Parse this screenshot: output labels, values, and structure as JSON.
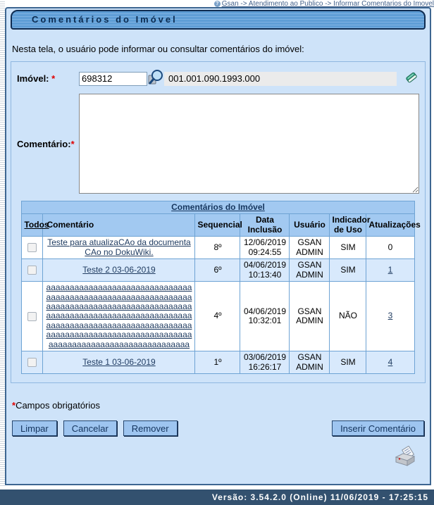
{
  "breadcrumb": {
    "text": "Gsan -> Atendimento ao Publico -> Informar Comentarios do Imovel",
    "help_icon": "question-mark-circle-icon"
  },
  "page": {
    "title": "Comentários do Imóvel",
    "description": "Nesta tela, o usuário pode informar ou consultar comentários do imóvel:"
  },
  "form": {
    "imovel": {
      "label": "Imóvel:",
      "required_marker": "*",
      "value": "698312",
      "inscricao": "001.001.090.1993.000",
      "search_icon": "magnifier",
      "clear_icon": "eraser"
    },
    "comentario": {
      "label": "Comentário:",
      "required_marker": "*",
      "value": ""
    }
  },
  "table": {
    "caption": "Comentários do Imóvel",
    "columns": [
      "Todos",
      "Comentário",
      "Sequencial",
      "Data Inclusão",
      "Usuário",
      "Indicador de Uso",
      "Atualizações"
    ],
    "rows": [
      {
        "checked": false,
        "comentario": "Teste para atualizaCAo da documentaCAo no DokuWiki.",
        "sequencial": "8º",
        "data_inclusao": "12/06/2019 09:24:55",
        "usuario": "GSAN ADMIN",
        "indicador_de_uso": "SIM",
        "atualizacoes": "0",
        "atualizacoes_is_link": false
      },
      {
        "checked": false,
        "comentario": "Teste 2 03-06-2019",
        "sequencial": "6º",
        "data_inclusao": "04/06/2019 10:13:40",
        "usuario": "GSAN ADMIN",
        "indicador_de_uso": "SIM",
        "atualizacoes": "1",
        "atualizacoes_is_link": true
      },
      {
        "checked": false,
        "comentario": "aaaaaaaaaaaaaaaaaaaaaaaaaaaaaaaaaaaaaaaaaaaaaaaaaaaaaaaaaaaaaaaaaaaaaaaaaaaaaaaaaaaaaaaaaaaaaaaaaaaaaaaaaaaaaaaaaaaaaaaaaaaaaaaaaaaaaaaaaaaaaaaaaaaaaaaaaaaaaaaaaaaaaaaaaaaaaaaaaaaaaaaaaaaaaaaaaaaaaaaaaaaaaaaaaaaaaaaa",
        "sequencial": "4º",
        "data_inclusao": "04/06/2019 10:32:01",
        "usuario": "GSAN ADMIN",
        "indicador_de_uso": "NÃO",
        "atualizacoes": "3",
        "atualizacoes_is_link": true
      },
      {
        "checked": false,
        "comentario": "Teste 1 03-06-2019",
        "sequencial": "1º",
        "data_inclusao": "03/06/2019 16:26:17",
        "usuario": "GSAN ADMIN",
        "indicador_de_uso": "SIM",
        "atualizacoes": "4",
        "atualizacoes_is_link": true
      }
    ]
  },
  "footnote": {
    "marker": "*",
    "text": "Campos obrigatórios"
  },
  "buttons": {
    "limpar": "Limpar",
    "cancelar": "Cancelar",
    "remover": "Remover",
    "inserir": "Inserir Comentário"
  },
  "icons": {
    "help": "question-mark-circle",
    "search": "magnifier",
    "clear_field": "eraser",
    "print": "printer"
  },
  "colors": {
    "frame_bg": "#cee3f9",
    "frame_border": "#3d6691",
    "table_header_bg": "#a2c9f1",
    "row_alt_bg": "#d8e9fc",
    "button_bg": "#9ec5f0",
    "footer_bg": "#33516f",
    "required": "#e00000"
  },
  "footer": {
    "version_text": "Versão: 3.54.2.0 (Online) 11/06/2019 - 17:25:15"
  }
}
